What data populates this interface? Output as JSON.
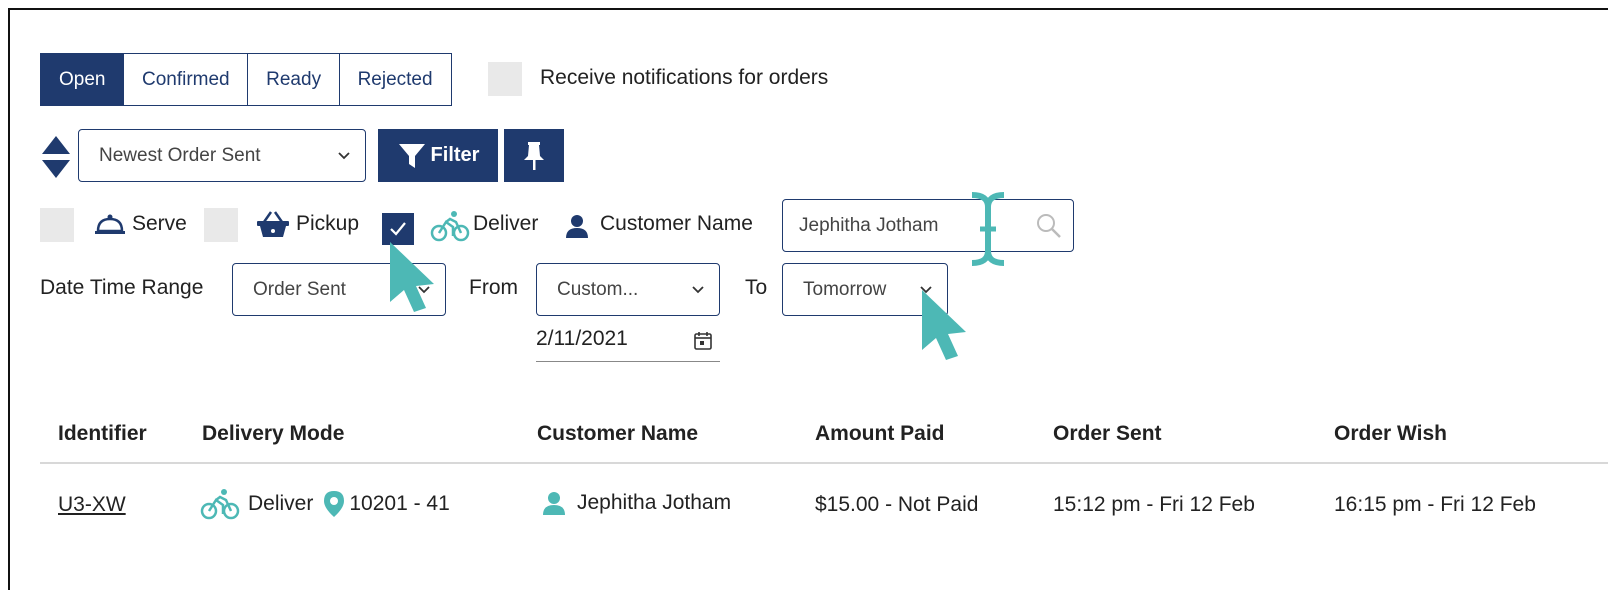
{
  "tabs": [
    {
      "label": "Open",
      "active": true
    },
    {
      "label": "Confirmed",
      "active": false
    },
    {
      "label": "Ready",
      "active": false
    },
    {
      "label": "Rejected",
      "active": false
    }
  ],
  "notifications": {
    "label": "Receive notifications for orders",
    "checked": false
  },
  "sort": {
    "selected": "Newest Order Sent"
  },
  "filter_button": {
    "label": "Filter"
  },
  "modes": {
    "serve": {
      "label": "Serve",
      "checked": false
    },
    "pickup": {
      "label": "Pickup",
      "checked": false
    },
    "deliver": {
      "label": "Deliver",
      "checked": true
    }
  },
  "customer_filter": {
    "label": "Customer Name",
    "value": "Jephitha Jotham"
  },
  "date_range": {
    "label": "Date Time Range",
    "type_selected": "Order Sent",
    "from_label": "From",
    "from_selected": "Custom...",
    "from_date": "2/11/2021",
    "to_label": "To",
    "to_selected": "Tomorrow"
  },
  "table": {
    "headers": [
      "Identifier",
      "Delivery Mode",
      "Customer Name",
      "Amount Paid",
      "Order Sent",
      "Order Wish"
    ],
    "rows": [
      {
        "identifier": "U3-XW",
        "delivery_mode": "Deliver",
        "location": "10201 - 41",
        "customer": "Jephitha Jotham",
        "amount": "$15.00 - Not Paid",
        "order_sent": "15:12 pm - Fri 12 Feb",
        "order_wish": "16:15 pm - Fri 12 Feb"
      }
    ]
  },
  "colors": {
    "primary": "#1f3a6e",
    "accent": "#4db8b5",
    "checkbox_bg": "#e9e9e9"
  }
}
